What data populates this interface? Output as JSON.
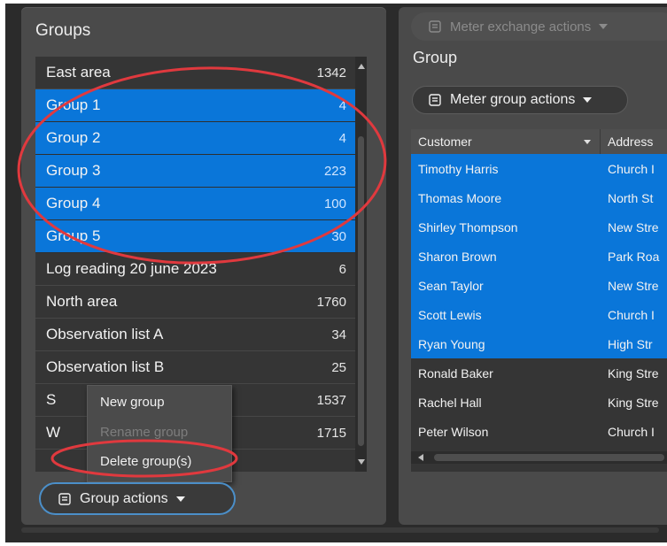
{
  "left_panel": {
    "title": "Groups",
    "groups": [
      {
        "name": "East area",
        "count": "1342",
        "selected": false
      },
      {
        "name": "Group 1",
        "count": "4",
        "selected": true
      },
      {
        "name": "Group 2",
        "count": "4",
        "selected": true
      },
      {
        "name": "Group 3",
        "count": "223",
        "selected": true
      },
      {
        "name": "Group 4",
        "count": "100",
        "selected": true
      },
      {
        "name": "Group 5",
        "count": "30",
        "selected": true
      },
      {
        "name": "Log reading 20 june 2023",
        "count": "6",
        "selected": false
      },
      {
        "name": "North area",
        "count": "1760",
        "selected": false
      },
      {
        "name": "Observation list A",
        "count": "34",
        "selected": false
      },
      {
        "name": "Observation list B",
        "count": "25",
        "selected": false
      },
      {
        "name": "S",
        "count": "1537",
        "selected": false
      },
      {
        "name": "W",
        "count": "1715",
        "selected": false
      }
    ],
    "context_menu": {
      "items": [
        {
          "label": "New group",
          "enabled": true
        },
        {
          "label": "Rename group",
          "enabled": false
        },
        {
          "label": "Delete group(s)",
          "enabled": true
        }
      ]
    },
    "group_actions_label": "Group actions"
  },
  "right_panel": {
    "meter_exchange_label": "Meter exchange actions",
    "title": "Group",
    "meter_group_actions_label": "Meter group actions",
    "columns": [
      "Customer",
      "Address"
    ],
    "rows": [
      {
        "customer": "Timothy Harris",
        "address": "Church I",
        "selected": true
      },
      {
        "customer": "Thomas Moore",
        "address": "North St",
        "selected": true
      },
      {
        "customer": "Shirley Thompson",
        "address": "New Stre",
        "selected": true
      },
      {
        "customer": "Sharon Brown",
        "address": "Park Roa",
        "selected": true
      },
      {
        "customer": "Sean Taylor",
        "address": "New Stre",
        "selected": true
      },
      {
        "customer": "Scott Lewis",
        "address": "Church I",
        "selected": true
      },
      {
        "customer": "Ryan Young",
        "address": "High Str",
        "selected": true
      },
      {
        "customer": "Ronald Baker",
        "address": "King Stre",
        "selected": false
      },
      {
        "customer": "Rachel Hall",
        "address": "King Stre",
        "selected": false
      },
      {
        "customer": "Peter Wilson",
        "address": "Church I",
        "selected": false
      }
    ]
  },
  "colors": {
    "selection": "#0a76d9",
    "annotation": "#e0393e",
    "panel": "#4a4a4a",
    "list_background": "#353535"
  }
}
